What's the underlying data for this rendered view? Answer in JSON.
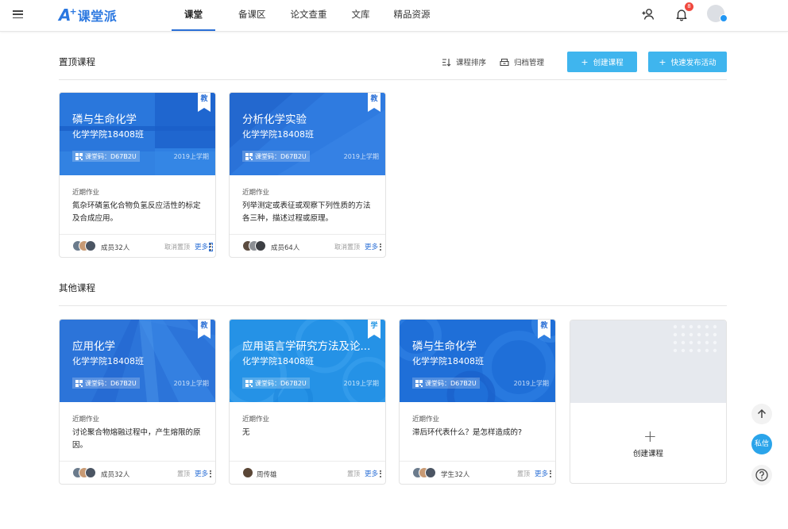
{
  "app": {
    "logo_text": "课堂派",
    "logo_letter": "A",
    "logo_plus": "+"
  },
  "nav": {
    "tabs": [
      {
        "label": "课堂",
        "active": true
      },
      {
        "label": "备课区"
      },
      {
        "label": "论文查重"
      },
      {
        "label": "文库"
      },
      {
        "label": "精品资源"
      }
    ]
  },
  "header": {
    "notification_count": "8"
  },
  "pinned": {
    "title": "置顶课程",
    "sort_label": "课程排序",
    "archive_label": "归档管理",
    "create_button": "创建课程",
    "publish_button": "快速发布活动"
  },
  "others": {
    "title": "其他课程"
  },
  "common": {
    "code_text": "课堂码：D67B2U",
    "term": "2019上学期",
    "hw_label": "近期作业",
    "more_label": "更多",
    "create_card_label": "创建课程"
  },
  "courses": [
    {
      "name": "磷与生命化学",
      "class": "化学学院18408班",
      "role": "教",
      "homework": "氮杂环磷氢化合物负氢反应活性的标定及合成应用。",
      "members": "成员32人",
      "pin_action": "取消置顶"
    },
    {
      "name": "分析化学实验",
      "class": "化学学院18408班",
      "role": "教",
      "homework": "列举测定或表征或观察下列性质的方法各三种，描述过程或原理。",
      "members": "成员64人",
      "pin_action": "取消置顶"
    },
    {
      "name": "应用化学",
      "class": "化学学院18408班",
      "role": "教",
      "homework": "讨论聚合物熔融过程中，产生熔限的原因。",
      "members": "成员32人",
      "pin_action": "置顶"
    },
    {
      "name": "应用语言学研究方法及论...",
      "class": "化学学院18408班",
      "role": "学",
      "homework": "无",
      "members": "周传雄",
      "pin_action": "置顶"
    },
    {
      "name": "磷与生命化学",
      "class": "化学学院18408班",
      "role": "教",
      "homework": "滞后环代表什么？是怎样造成的?",
      "members": "学生32人",
      "pin_action": "置顶"
    }
  ],
  "floating": {
    "private_message": "私信"
  },
  "colors": {
    "accent": "#3fb5ee",
    "nav_underline": "#2a6fd6",
    "banner_blue": "#2a6fd6",
    "badge_red": "#f0483e"
  },
  "icons": [
    "menu-icon",
    "add-user-icon",
    "bell-icon",
    "sort-icon",
    "archive-icon",
    "qr-code-icon",
    "arrow-up-icon",
    "question-icon",
    "plus-icon"
  ]
}
